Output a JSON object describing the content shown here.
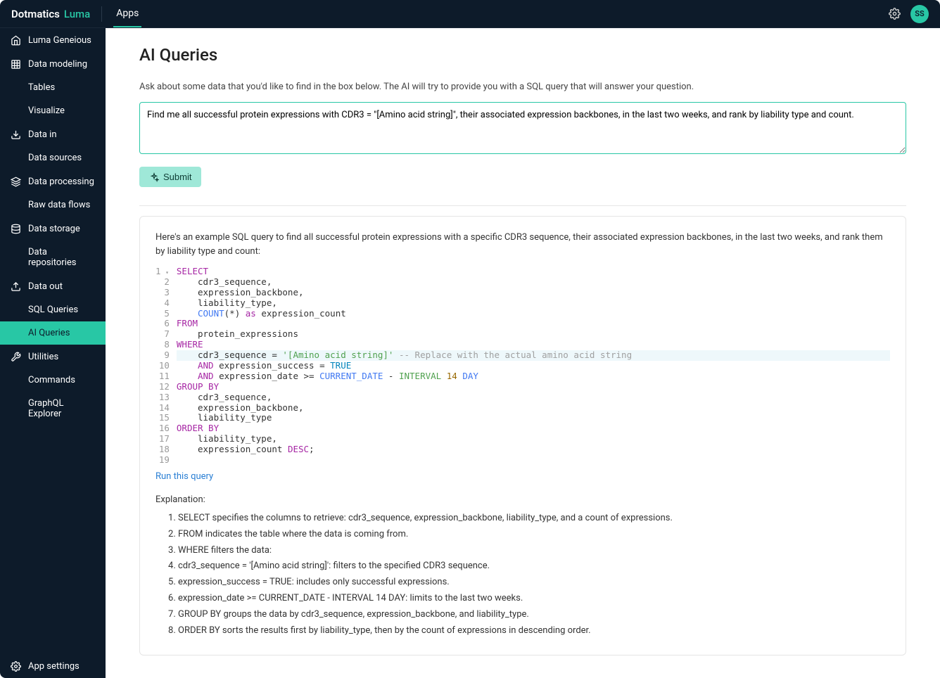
{
  "topbar": {
    "brand_main": "Dotmatics",
    "brand_sub": "Luma",
    "nav_apps": "Apps",
    "avatar_initials": "SS"
  },
  "sidebar": {
    "luma_geneious": "Luma Geneious",
    "data_modeling": "Data modeling",
    "tables": "Tables",
    "visualize": "Visualize",
    "data_in": "Data in",
    "data_sources": "Data sources",
    "data_processing": "Data processing",
    "raw_data_flows": "Raw data flows",
    "data_storage": "Data storage",
    "data_repositories": "Data repositories",
    "data_out": "Data out",
    "sql_queries": "SQL Queries",
    "ai_queries": "AI Queries",
    "utilities": "Utilities",
    "commands": "Commands",
    "graphql_explorer": "GraphQL Explorer",
    "app_settings": "App settings"
  },
  "main": {
    "title": "AI Queries",
    "instructions": "Ask about some data that you'd like to find in the box below. The AI will try to provide you with a SQL query that will answer your question.",
    "query_value": "Find me all successful protein expressions with CDR3 = \"[Amino acid string]\", their associated expression backbones, in the last two weeks, and rank by liability type and count.",
    "submit_label": "Submit",
    "result_intro": "Here's an example SQL query to find all successful protein expressions with a specific CDR3 sequence, their associated expression backbones, in the last two weeks, and rank them by liability type and count:",
    "run_link": "Run this query",
    "explanation_title": "Explanation:",
    "explanations": [
      "SELECT specifies the columns to retrieve: cdr3_sequence, expression_backbone, liability_type, and a count of expressions.",
      "FROM indicates the table where the data is coming from.",
      "WHERE filters the data:",
      "cdr3_sequence = '[Amino acid string]': filters to the specified CDR3 sequence.",
      "expression_success = TRUE: includes only successful expressions.",
      "expression_date >= CURRENT_DATE - INTERVAL 14 DAY: limits to the last two weeks.",
      "GROUP BY groups the data by cdr3_sequence, expression_backbone, and liability_type.",
      "ORDER BY sorts the results first by liability_type, then by the count of expressions in descending order."
    ],
    "code": {
      "line_count": 19,
      "highlighted_line": 9,
      "foldable_line": 1,
      "l1_select": "SELECT",
      "l2": "    cdr3_sequence,",
      "l3": "    expression_backbone,",
      "l4": "    liability_type,",
      "l5_count": "COUNT",
      "l5_star": "(*) ",
      "l5_as": "as",
      "l5_rest": " expression_count",
      "l6_from": "FROM",
      "l7": "    protein_expressions",
      "l8_where": "WHERE",
      "l9_pre": "    cdr3_sequence = ",
      "l9_str": "'[Amino acid string]'",
      "l9_cmt": " -- Replace with the actual amino acid string",
      "l10_and": "AND",
      "l10_rest": " expression_success = ",
      "l10_true": "TRUE",
      "l11_and": "AND",
      "l11_rest": " expression_date >= ",
      "l11_cd": "CURRENT_DATE",
      "l11_dash": " - ",
      "l11_interval": "INTERVAL",
      "l11_sp": " ",
      "l11_num": "14",
      "l11_sp2": " ",
      "l11_day": "DAY",
      "l12_group": "GROUP BY",
      "l13": "    cdr3_sequence,",
      "l14": "    expression_backbone,",
      "l15": "    liability_type",
      "l16_order": "ORDER BY",
      "l17": "    liability_type,",
      "l18_pre": "    expression_count ",
      "l18_desc": "DESC",
      "l18_semi": ";"
    }
  }
}
